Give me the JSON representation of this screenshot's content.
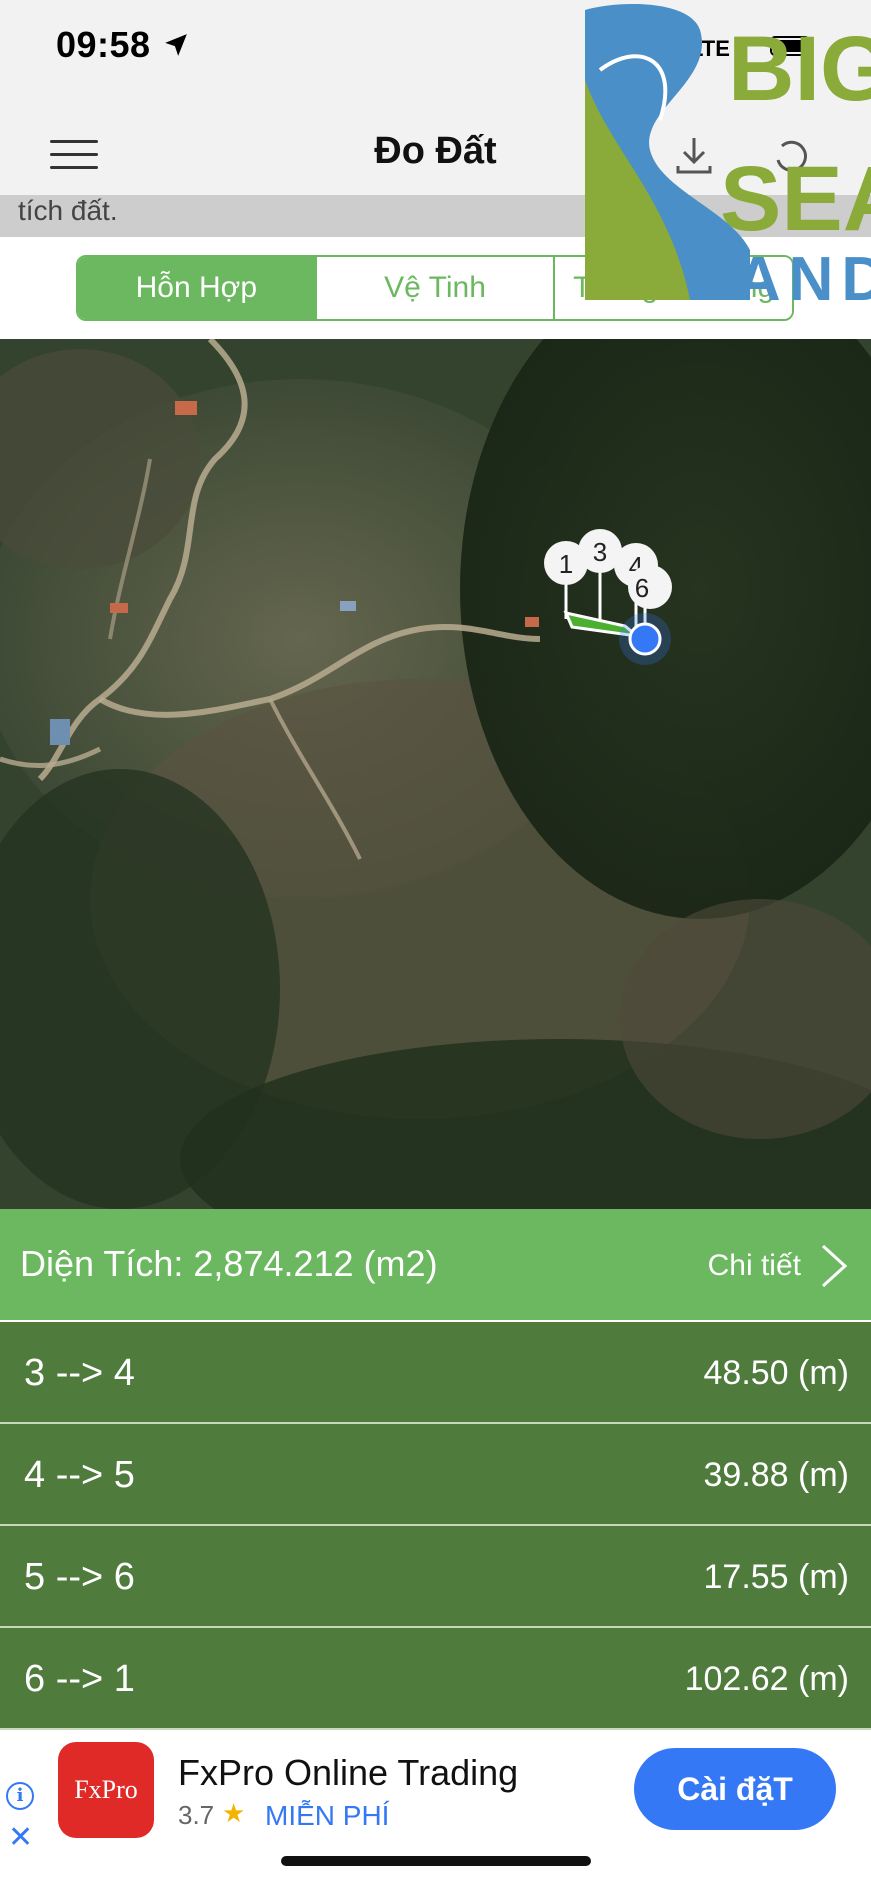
{
  "status_bar": {
    "time": "09:58",
    "carrier_text": "LTE"
  },
  "nav": {
    "title": "Đo Đất",
    "menu_icon": "hamburger-icon",
    "action_icons": [
      "share-icon",
      "download-icon",
      "undo-icon"
    ]
  },
  "notice": {
    "text": "tích đất."
  },
  "map_type_tabs": [
    {
      "label": "Hỗn Hợp",
      "active": true
    },
    {
      "label": "Vệ Tinh",
      "active": false
    },
    {
      "label": "Thông Thường",
      "active": false
    }
  ],
  "map": {
    "pins": [
      "1",
      "3",
      "4",
      "6"
    ],
    "parcel_color": "#4caf2f"
  },
  "logo": {
    "text_lines": [
      "BIG",
      "SEA",
      "LAND"
    ]
  },
  "area": {
    "label": "Diện Tích: 2,874.212 (m2)",
    "detail_link": "Chi tiết"
  },
  "segments": [
    {
      "segment": "3 --> 4",
      "distance": "48.50 (m)"
    },
    {
      "segment": "4 --> 5",
      "distance": "39.88 (m)"
    },
    {
      "segment": "5 --> 6",
      "distance": "17.55 (m)"
    },
    {
      "segment": "6 --> 1",
      "distance": "102.62 (m)"
    }
  ],
  "ad": {
    "logo_text": "FxPro",
    "title": "FxPro Online Trading",
    "rating": "3.7",
    "price": "MIỄN PHÍ",
    "install_label": "Cài đặT"
  },
  "colors": {
    "accent_green": "#6cb860",
    "row_green": "#4f7b3d",
    "ad_blue": "#3478f6"
  }
}
